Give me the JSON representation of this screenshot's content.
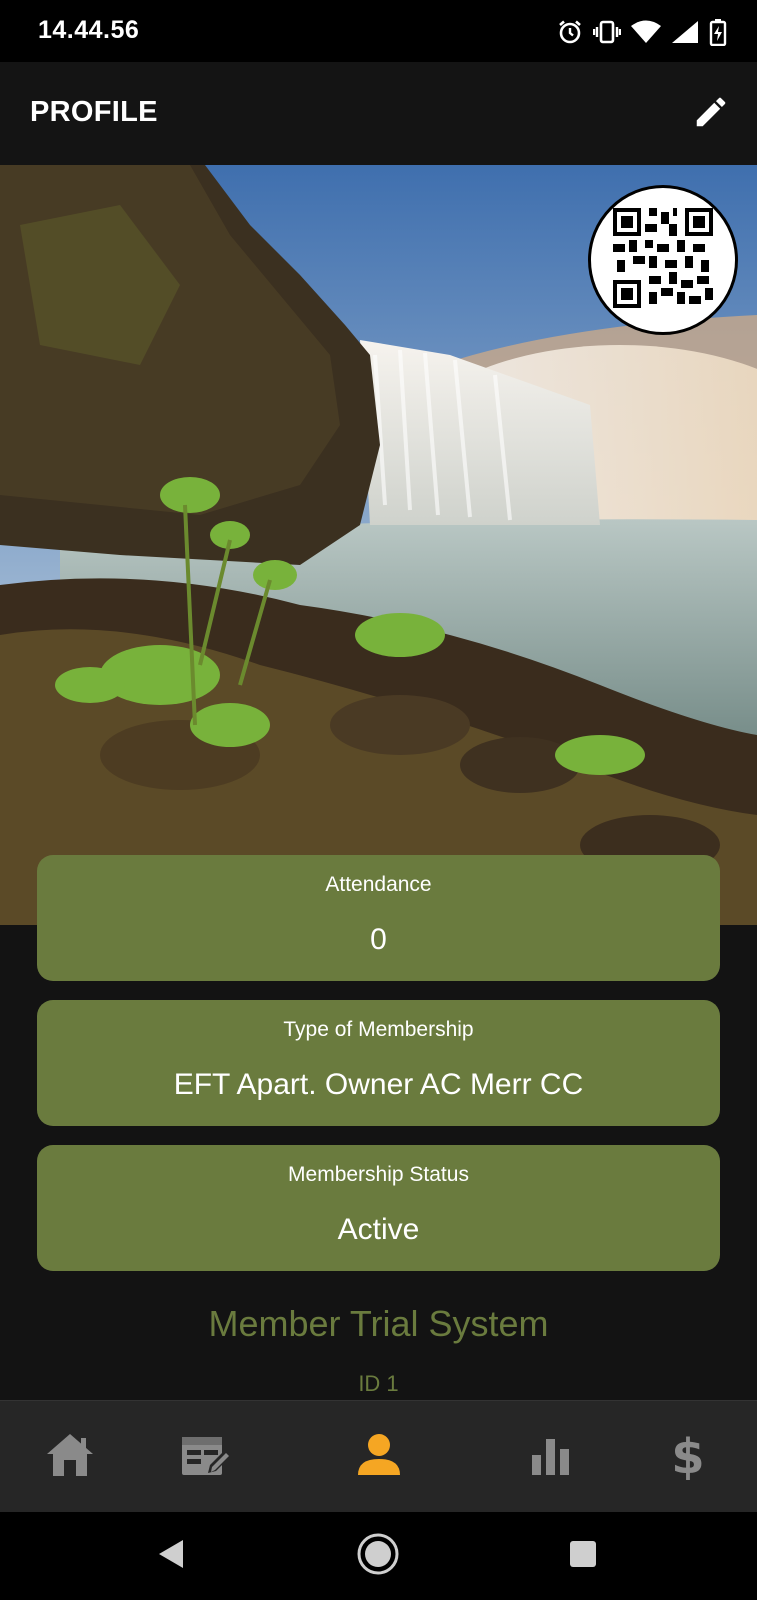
{
  "status_bar": {
    "time": "14.44.56",
    "icons": [
      "alarm-icon",
      "vibrate-icon",
      "wifi-icon",
      "cell-signal-icon",
      "battery-charging-icon"
    ]
  },
  "app_bar": {
    "title": "PROFILE",
    "edit_icon": "pencil-icon"
  },
  "hero": {
    "image": "waterfall landscape",
    "qr_icon": "qr-code-icon"
  },
  "cards": [
    {
      "label": "Attendance",
      "value": "0"
    },
    {
      "label": "Type of Membership",
      "value": "EFT Apart. Owner AC Merr CC"
    },
    {
      "label": "Membership Status",
      "value": "Active"
    }
  ],
  "member": {
    "name": "Member Trial System",
    "id": "ID 1"
  },
  "bottom_nav": {
    "items": [
      {
        "icon": "home-icon",
        "active": false
      },
      {
        "icon": "schedule-edit-icon",
        "active": false
      },
      {
        "icon": "profile-icon",
        "active": true
      },
      {
        "icon": "stats-icon",
        "active": false
      },
      {
        "icon": "dollar-icon",
        "active": false
      }
    ],
    "active_color": "#f5a623",
    "inactive_color": "#8a8a8a"
  },
  "system_nav": {
    "icons": [
      "back-icon",
      "home-circle-icon",
      "recents-icon"
    ]
  },
  "colors": {
    "card_bg": "#6a7b3e",
    "page_bg": "#131313",
    "accent": "#f5a623"
  }
}
